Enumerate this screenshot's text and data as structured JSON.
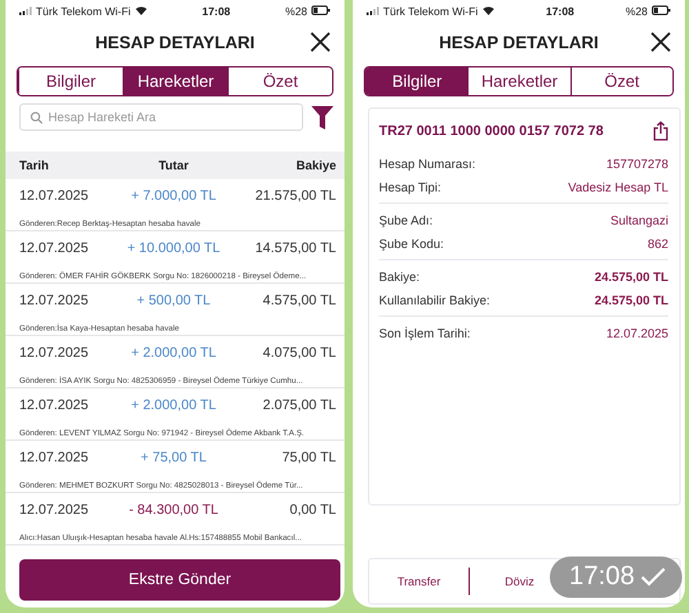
{
  "left_screen": {
    "status_bar": {
      "carrier": "Türk Telekom Wi-Fi",
      "time": "17:08",
      "battery": "%28"
    },
    "title": "HESAP DETAYLARI",
    "tabs": [
      {
        "label": "Bilgiler",
        "selected": false
      },
      {
        "label": "Hareketler",
        "selected": true
      },
      {
        "label": "Özet",
        "selected": false
      }
    ],
    "search": {
      "placeholder": "Hesap Hareketi Ara"
    },
    "table": {
      "columns": [
        "Tarih",
        "Tutar",
        "Bakiye"
      ],
      "rows": [
        {
          "date": "12.07.2025",
          "amount": "+ 7.000,00 TL",
          "kind": "credit",
          "balance": "21.575,00 TL",
          "description": "Gönderen:Recep Berktaş-Hesaptan hesaba havale"
        },
        {
          "date": "12.07.2025",
          "amount": "+ 10.000,00 TL",
          "kind": "credit",
          "balance": "14.575,00 TL",
          "description": "Gönderen: ÖMER FAHİR GÖKBERK Sorgu No: 1826000218 - Bireysel Ödeme..."
        },
        {
          "date": "12.07.2025",
          "amount": "+ 500,00 TL",
          "kind": "credit",
          "balance": "4.575,00 TL",
          "description": "Gönderen:İsa Kaya-Hesaptan hesaba havale"
        },
        {
          "date": "12.07.2025",
          "amount": "+ 2.000,00 TL",
          "kind": "credit",
          "balance": "4.075,00 TL",
          "description": "Gönderen: İSA AYIK Sorgu No: 4825306959 - Bireysel Ödeme Türkiye Cumhu..."
        },
        {
          "date": "12.07.2025",
          "amount": "+ 2.000,00 TL",
          "kind": "credit",
          "balance": "2.075,00 TL",
          "description": "Gönderen: LEVENT YILMAZ Sorgu No: 971942 - Bireysel Ödeme Akbank T.A.Ş."
        },
        {
          "date": "12.07.2025",
          "amount": "+ 75,00 TL",
          "kind": "credit",
          "balance": "75,00 TL",
          "description": "Gönderen: MEHMET BOZKURT Sorgu No: 4825028013 - Bireysel Ödeme Tür..."
        },
        {
          "date": "12.07.2025",
          "amount": "- 84.300,00 TL",
          "kind": "debit",
          "balance": "0,00 TL",
          "description": "Alıcı:Hasan Uluışık-Hesaptan hesaba havale Al.Hs:157488855 Mobil Bankacıl..."
        }
      ]
    },
    "button": "Ekstre Gönder"
  },
  "right_screen": {
    "status_bar": {
      "carrier": "Türk Telekom Wi-Fi",
      "time": "17:08",
      "battery": "%28"
    },
    "title": "HESAP DETAYLARI",
    "tabs": [
      {
        "label": "Bilgiler",
        "selected": true
      },
      {
        "label": "Hareketler",
        "selected": false
      },
      {
        "label": "Özet",
        "selected": false
      }
    ],
    "iban": "TR27 0011 1000 0000 0157 7072 78",
    "groups": [
      [
        {
          "label": "Hesap Numarası:",
          "value": "157707278",
          "bold": false
        },
        {
          "label": "Hesap Tipi:",
          "value": "Vadesiz Hesap TL",
          "bold": false
        }
      ],
      [
        {
          "label": "Şube Adı:",
          "value": "Sultangazi",
          "bold": false
        },
        {
          "label": "Şube Kodu:",
          "value": "862",
          "bold": false
        }
      ],
      [
        {
          "label": "Bakiye:",
          "value": "24.575,00 TL",
          "bold": true
        },
        {
          "label": "Kullanılabilir Bakiye:",
          "value": "24.575,00 TL",
          "bold": true
        }
      ],
      [
        {
          "label": "Son İşlem Tarihi:",
          "value": "12.07.2025",
          "bold": false
        }
      ]
    ],
    "actions": [
      "Transfer",
      "Döviz"
    ]
  },
  "overlay": {
    "time": "17:08"
  }
}
